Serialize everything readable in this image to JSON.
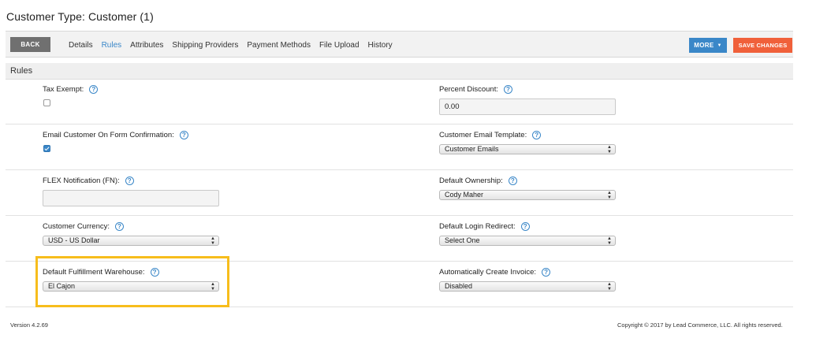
{
  "page": {
    "title": "Customer Type: Customer (1)"
  },
  "toolbar": {
    "back_label": "BACK",
    "tabs": [
      {
        "label": "Details",
        "active": false
      },
      {
        "label": "Rules",
        "active": true
      },
      {
        "label": "Attributes",
        "active": false
      },
      {
        "label": "Shipping Providers",
        "active": false
      },
      {
        "label": "Payment Methods",
        "active": false
      },
      {
        "label": "File Upload",
        "active": false
      },
      {
        "label": "History",
        "active": false
      }
    ],
    "more_label": "MORE",
    "save_label": "SAVE CHANGES"
  },
  "section": {
    "title": "Rules"
  },
  "help_glyph": "?",
  "fields": {
    "tax_exempt": {
      "label": "Tax Exempt:",
      "checked": false
    },
    "percent_discount": {
      "label": "Percent Discount:",
      "value": "0.00"
    },
    "email_customer": {
      "label": "Email Customer On Form Confirmation:",
      "checked": true
    },
    "customer_email_template": {
      "label": "Customer Email Template:",
      "value": "Customer Emails"
    },
    "flex_notification": {
      "label": "FLEX Notification (FN):",
      "value": ""
    },
    "default_ownership": {
      "label": "Default Ownership:",
      "value": "Cody Maher"
    },
    "customer_currency": {
      "label": "Customer Currency:",
      "value": "USD - US Dollar"
    },
    "default_login_redirect": {
      "label": "Default Login Redirect:",
      "value": "Select One"
    },
    "default_fulfillment_warehouse": {
      "label": "Default Fulfillment Warehouse:",
      "value": "El Cajon"
    },
    "auto_create_invoice": {
      "label": "Automatically Create Invoice:",
      "value": "Disabled"
    }
  },
  "footer": {
    "version": "Version 4.2.69",
    "copyright": "Copyright © 2017 by Lead Commerce, LLC. All rights reserved."
  },
  "colors": {
    "accent_blue": "#3a87c8",
    "save_orange": "#f0603a",
    "back_gray": "#707070",
    "highlight_yellow": "#f7bd1c"
  }
}
